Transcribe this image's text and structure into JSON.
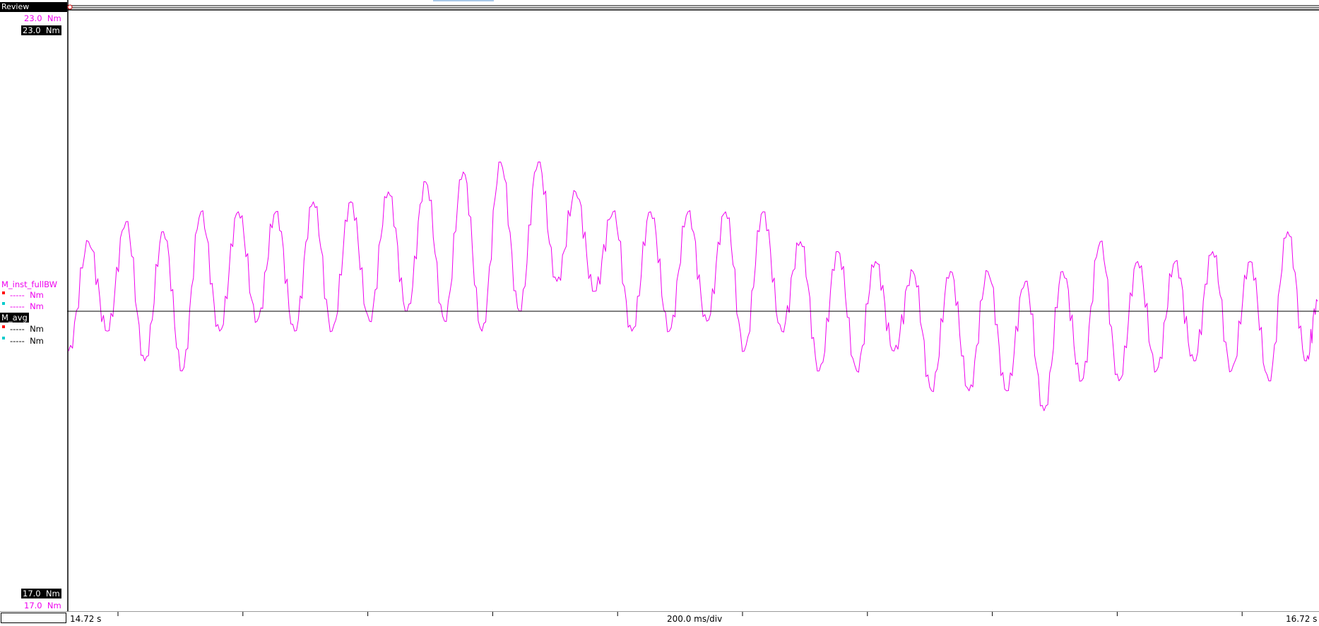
{
  "window": {
    "mode_label": "Review"
  },
  "y_scale": {
    "top": {
      "value": "23.0",
      "unit": "Nm"
    },
    "bottom": {
      "value": "17.0",
      "unit": "Nm"
    }
  },
  "channels": [
    {
      "name": "M_inst_fullBW",
      "color": "#ee00ee",
      "cursor_a": {
        "value": "-----",
        "unit": "Nm"
      },
      "cursor_b": {
        "value": "-----",
        "unit": "Nm"
      }
    },
    {
      "name": "M_avg",
      "color": "#000000",
      "cursor_a": {
        "value": "-----",
        "unit": "Nm"
      },
      "cursor_b": {
        "value": "-----",
        "unit": "Nm"
      }
    }
  ],
  "time_axis": {
    "start": "14.72 s",
    "end": "16.72 s",
    "division": "200.0 ms/div"
  },
  "colors": {
    "trace": "#ee00ee",
    "avg": "#000000",
    "cursor_a": "#ff0000",
    "cursor_b": "#00cccc"
  },
  "chart_data": {
    "type": "line",
    "title": "",
    "xlabel": "",
    "ylabel": "",
    "xlim": [
      14.72,
      16.72
    ],
    "ylim": [
      17.0,
      23.0
    ],
    "series": [
      {
        "name": "M_inst_fullBW",
        "x": [
          14.72,
          14.752,
          14.782,
          14.812,
          14.842,
          14.872,
          14.902,
          14.932,
          14.962,
          14.992,
          15.022,
          15.052,
          15.082,
          15.112,
          15.142,
          15.172,
          15.202,
          15.232,
          15.262,
          15.292,
          15.322,
          15.352,
          15.382,
          15.412,
          15.442,
          15.472,
          15.502,
          15.532,
          15.562,
          15.592,
          15.622,
          15.652,
          15.682,
          15.712,
          15.742,
          15.772,
          15.802,
          15.832,
          15.862,
          15.892,
          15.922,
          15.952,
          15.982,
          16.012,
          16.042,
          16.072,
          16.102,
          16.132,
          16.162,
          16.192,
          16.222,
          16.252,
          16.282,
          16.312,
          16.342,
          16.372,
          16.402,
          16.432,
          16.462,
          16.492,
          16.522,
          16.552,
          16.582,
          16.612,
          16.642,
          16.672,
          16.702,
          16.72
        ],
        "y": [
          19.6,
          20.7,
          19.8,
          20.9,
          19.5,
          20.8,
          19.4,
          21.0,
          19.8,
          21.0,
          19.9,
          21.0,
          19.8,
          21.1,
          19.8,
          21.1,
          19.9,
          21.2,
          20.0,
          21.3,
          19.9,
          21.4,
          19.8,
          21.5,
          20.0,
          21.5,
          20.3,
          21.2,
          20.2,
          21.0,
          19.8,
          21.0,
          19.8,
          21.0,
          19.9,
          21.0,
          19.6,
          21.0,
          19.8,
          20.7,
          19.4,
          20.6,
          19.4,
          20.5,
          19.6,
          20.4,
          19.2,
          20.4,
          19.2,
          20.4,
          19.2,
          20.3,
          19.0,
          20.4,
          19.3,
          20.7,
          19.3,
          20.5,
          19.4,
          20.5,
          19.5,
          20.6,
          19.4,
          20.5,
          19.3,
          20.8,
          19.5,
          20.1
        ]
      },
      {
        "name": "M_avg",
        "x": [
          14.72,
          16.72
        ],
        "y": [
          20.0,
          20.0
        ]
      }
    ]
  }
}
